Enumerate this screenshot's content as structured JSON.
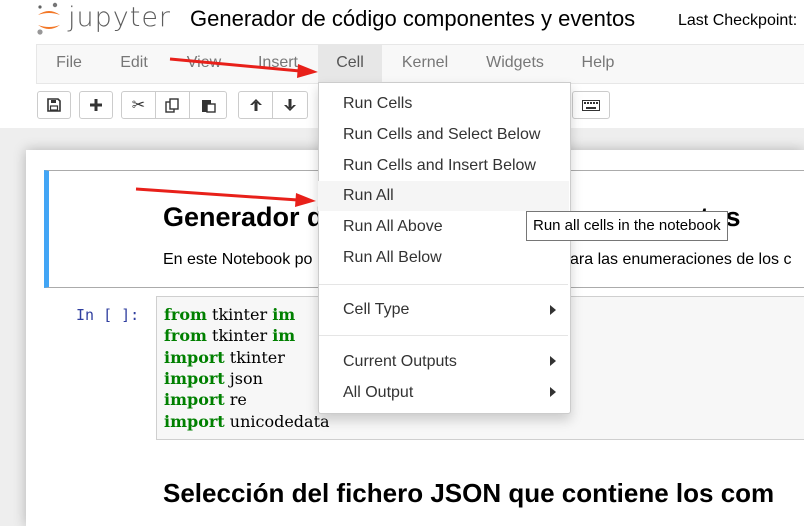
{
  "header": {
    "logo_text": "jupyter",
    "notebook_title": "Generador de código componentes y eventos",
    "checkpoint": "Last Checkpoint:"
  },
  "menubar": {
    "file": "File",
    "edit": "Edit",
    "view": "View",
    "insert": "Insert",
    "cell": "Cell",
    "kernel": "Kernel",
    "widgets": "Widgets",
    "help": "Help"
  },
  "toolbar": {
    "icons": [
      "save-icon",
      "plus-icon",
      "scissors-icon",
      "copy-icon",
      "paste-icon",
      "arrow-up-icon",
      "arrow-down-icon",
      "keyboard-icon"
    ]
  },
  "cell_menu": {
    "items": [
      "Run Cells",
      "Run Cells and Select Below",
      "Run Cells and Insert Below",
      "Run All",
      "Run All Above",
      "Run All Below",
      "Cell Type",
      "Current Outputs",
      "All Output"
    ]
  },
  "tooltip": "Run all cells in the notebook",
  "notebook": {
    "md_title": "Generador d",
    "md_title_right": "tos",
    "md_text": "En este Notebook po",
    "md_text_right": "ara las enumeraciones de los c",
    "prompt": "In [ ]:",
    "code": [
      {
        "kw": "from",
        "rest": " tkinter ",
        "tail": "im"
      },
      {
        "kw": "from",
        "rest": " tkinter ",
        "tail": "im"
      },
      {
        "kw": "import",
        "rest": " tkinter",
        "tail": ""
      },
      {
        "kw": "import",
        "rest": " json",
        "tail": ""
      },
      {
        "kw": "import",
        "rest": " re",
        "tail": ""
      },
      {
        "kw": "import",
        "rest": " unicodedata",
        "tail": ""
      }
    ],
    "section_heading": "Selección del fichero JSON que contiene los com"
  },
  "colors": {
    "accent_blue": "#42a5f5",
    "keyword_green": "#008000",
    "prompt_blue": "#303f9f",
    "annotation_red": "#e8201a",
    "jupyter_orange": "#f37726"
  }
}
